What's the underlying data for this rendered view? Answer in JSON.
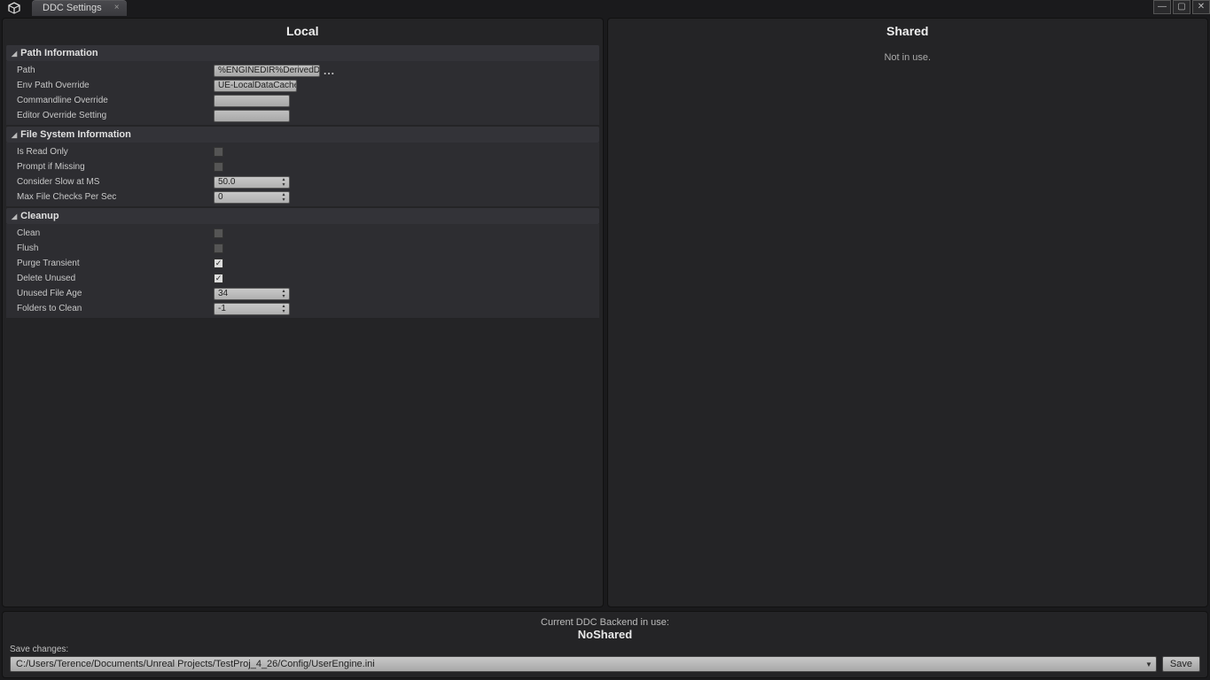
{
  "tab": {
    "title": "DDC Settings"
  },
  "panes": {
    "local": {
      "title": "Local"
    },
    "shared": {
      "title": "Shared",
      "status": "Not in use."
    }
  },
  "sections": {
    "path_info": {
      "title": "Path Information",
      "rows": {
        "path": {
          "label": "Path",
          "value": "%ENGINEDIR%DerivedDataCache"
        },
        "env_override": {
          "label": "Env Path Override",
          "value": "UE-LocalDataCachePath"
        },
        "cmd_override": {
          "label": "Commandline Override",
          "value": ""
        },
        "editor_override": {
          "label": "Editor Override Setting",
          "value": ""
        }
      }
    },
    "fs_info": {
      "title": "File System Information",
      "rows": {
        "readonly": {
          "label": "Is Read Only",
          "checked": false
        },
        "prompt": {
          "label": "Prompt if Missing",
          "checked": false
        },
        "slow_ms": {
          "label": "Consider Slow at MS",
          "value": "50.0"
        },
        "max_checks": {
          "label": "Max File Checks Per Sec",
          "value": "0"
        }
      }
    },
    "cleanup": {
      "title": "Cleanup",
      "rows": {
        "clean": {
          "label": "Clean",
          "checked": false
        },
        "flush": {
          "label": "Flush",
          "checked": false
        },
        "purge": {
          "label": "Purge Transient",
          "checked": true
        },
        "delete_unused": {
          "label": "Delete Unused",
          "checked": true
        },
        "unused_age": {
          "label": "Unused File Age",
          "value": "34"
        },
        "folders": {
          "label": "Folders to Clean",
          "value": "-1"
        }
      }
    }
  },
  "backend": {
    "label": "Current DDC Backend in use:",
    "value": "NoShared"
  },
  "save": {
    "label": "Save changes:",
    "path": "C:/Users/Terence/Documents/Unreal Projects/TestProj_4_26/Config/UserEngine.ini",
    "button": "Save"
  }
}
